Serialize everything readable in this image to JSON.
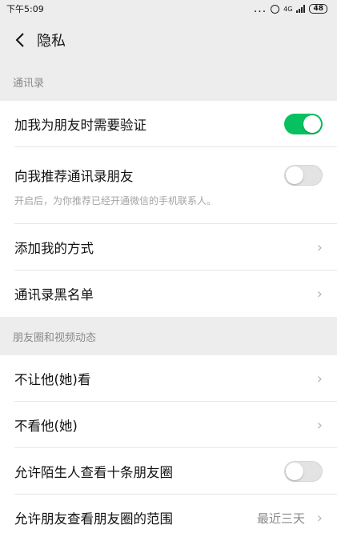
{
  "status_bar": {
    "time": "下午5:09",
    "dots": "...",
    "network": "4G",
    "battery": "48"
  },
  "header": {
    "title": "隐私"
  },
  "sections": [
    {
      "label": "通讯录",
      "rows": [
        {
          "label": "加我为朋友时需要验证",
          "type": "toggle",
          "on": true
        },
        {
          "label": "向我推荐通讯录朋友",
          "type": "toggle",
          "on": false,
          "hint": "开启后，为你推荐已经开通微信的手机联系人。"
        },
        {
          "label": "添加我的方式",
          "type": "link"
        },
        {
          "label": "通讯录黑名单",
          "type": "link"
        }
      ]
    },
    {
      "label": "朋友圈和视频动态",
      "rows": [
        {
          "label": "不让他(她)看",
          "type": "link"
        },
        {
          "label": "不看他(她)",
          "type": "link"
        },
        {
          "label": "允许陌生人查看十条朋友圈",
          "type": "toggle",
          "on": false
        },
        {
          "label": "允许朋友查看朋友圈的范围",
          "type": "link",
          "value": "最近三天"
        }
      ]
    }
  ],
  "colors": {
    "accent": "#07c160",
    "background": "#ededed"
  },
  "icons": {
    "back": "chevron-left-icon",
    "chevron": "chevron-right-icon"
  }
}
